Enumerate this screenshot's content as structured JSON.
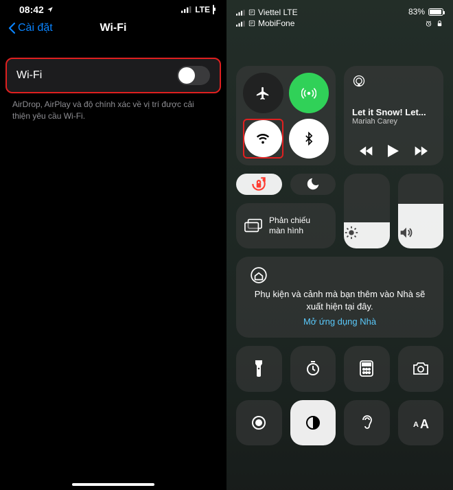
{
  "left": {
    "status": {
      "time": "08:42",
      "network": "LTE"
    },
    "nav": {
      "back_label": "Cài đặt",
      "title": "Wi-Fi"
    },
    "row": {
      "label": "Wi-Fi",
      "enabled": false
    },
    "desc": "AirDrop, AirPlay và độ chính xác về vị trí được cải thiện yêu cầu Wi-Fi."
  },
  "right": {
    "status": {
      "carrier1": "Viettel LTE",
      "carrier2": "MobiFone",
      "battery_pct": "83%"
    },
    "media": {
      "title": "Let it Snow! Let...",
      "artist": "Mariah Carey"
    },
    "mirror": {
      "label": "Phản chiếu màn hình"
    },
    "home": {
      "text": "Phụ kiện và cảnh mà bạn thêm vào Nhà sẽ xuất hiện tại đây.",
      "link": "Mở ứng dụng Nhà"
    }
  }
}
